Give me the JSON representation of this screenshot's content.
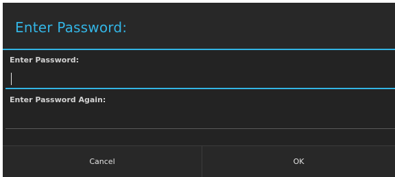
{
  "dialog": {
    "title": "Enter Password:",
    "fields": [
      {
        "label": "Enter Password:",
        "value": "",
        "focused": true
      },
      {
        "label": "Enter Password Again:",
        "value": "",
        "focused": false
      }
    ],
    "buttons": {
      "cancel_label": "Cancel",
      "ok_label": "OK"
    }
  },
  "colors": {
    "accent": "#33b5e5",
    "background": "#282828",
    "text": "#e2e2e2"
  }
}
